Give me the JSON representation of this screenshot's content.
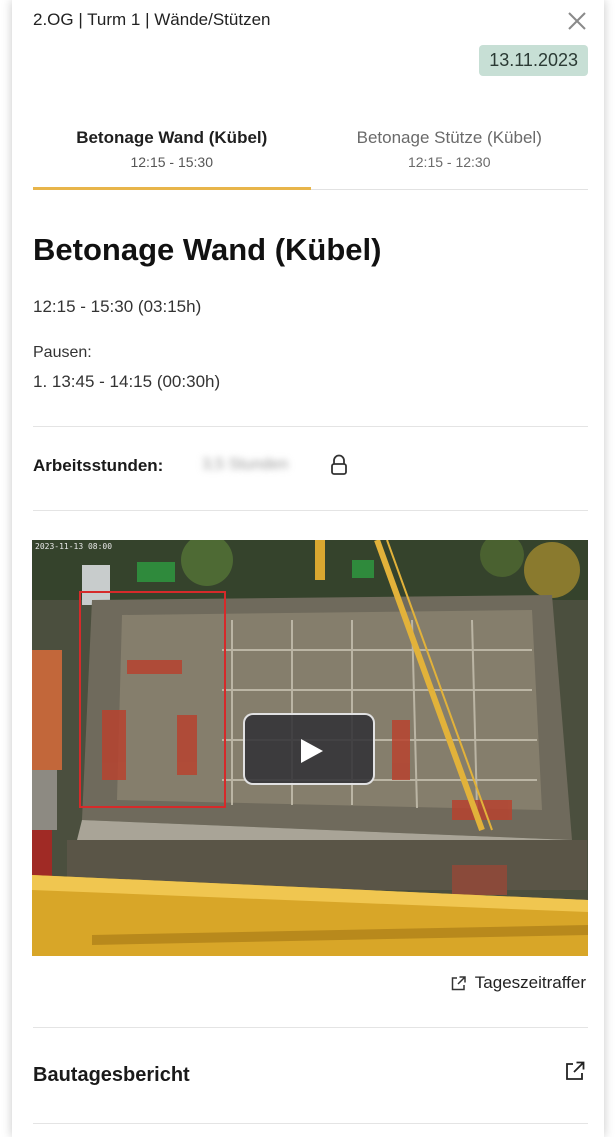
{
  "header": {
    "breadcrumb": "2.OG | Turm 1 | Wände/Stützen",
    "date": "13.11.2023"
  },
  "tabs": [
    {
      "label": "Betonage Wand (Kübel)",
      "time": "12:15 - 15:30",
      "active": true
    },
    {
      "label": "Betonage Stütze (Kübel)",
      "time": "12:15 - 12:30",
      "active": false
    }
  ],
  "detail": {
    "title": "Betonage Wand (Kübel)",
    "time_range": "12:15 - 15:30 (03:15h)",
    "pausen_label": "Pausen:",
    "pausen": [
      "1. 13:45 - 14:15 (00:30h)"
    ],
    "hours_label": "Arbeitsstunden:",
    "hours_value": "3,5 Stunden"
  },
  "video": {
    "timestamp": "2023-11-13 08:00",
    "play_icon": "play-icon"
  },
  "links": {
    "timelapse_label": "Tageszeitraffer",
    "report_label": "Bautagesbericht"
  },
  "colors": {
    "accent": "#e8b54a",
    "badge_bg": "#c7dfd5"
  }
}
